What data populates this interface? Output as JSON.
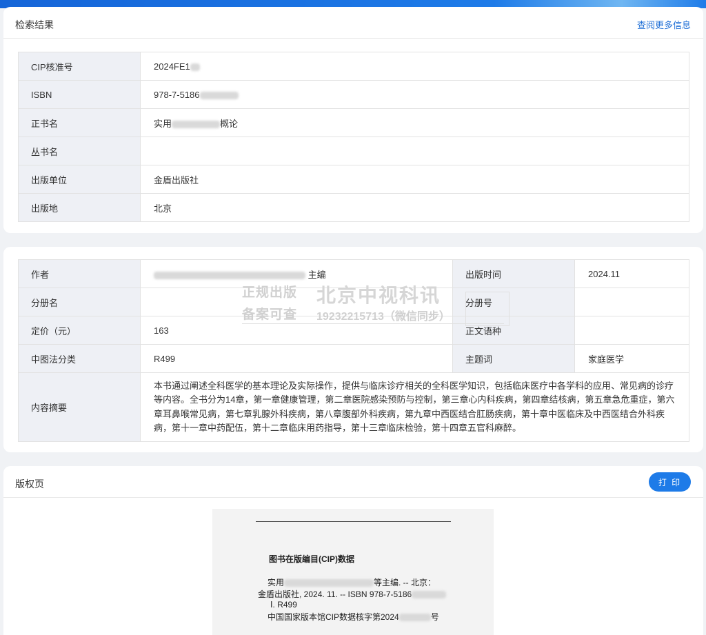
{
  "colors": {
    "accent": "#1e7be8",
    "label_bg": "#eef0f5",
    "page_bg": "#f0f2f5"
  },
  "results": {
    "title": "检索结果",
    "more_link": "查阅更多信息",
    "rows": [
      {
        "label": "CIP核准号",
        "value": "2024FE1"
      },
      {
        "label": "ISBN",
        "value": "978-7-5186"
      },
      {
        "label": "正书名",
        "value_prefix": "实用",
        "value_suffix": "概论"
      },
      {
        "label": "丛书名",
        "value": ""
      },
      {
        "label": "出版单位",
        "value": "金盾出版社"
      },
      {
        "label": "出版地",
        "value": "北京"
      }
    ]
  },
  "details": {
    "author_label": "作者",
    "author_suffix": "主编",
    "pubdate_label": "出版时间",
    "pubdate_value": "2024.11",
    "volume_label": "分册名",
    "volume_no_label": "分册号",
    "price_label": "定价（元）",
    "price_value": "163",
    "language_label": "正文语种",
    "clc_label": "中图法分类",
    "clc_value": "R499",
    "subject_label": "主题词",
    "subject_value": "家庭医学",
    "abstract_label": "内容摘要",
    "abstract_value": "本书通过阐述全科医学的基本理论及实际操作，提供与临床诊疗相关的全科医学知识，包括临床医疗中各学科的应用、常见病的诊疗等内容。全书分为14章，第一章健康管理，第二章医院感染预防与控制，第三章心内科疾病，第四章结核病，第五章急危重症，第六章耳鼻喉常见病，第七章乳腺外科疾病，第八章腹部外科疾病，第九章中西医结合肛肠疾病，第十章中医临床及中西医结合外科疾病，第十一章中药配伍，第十二章临床用药指导，第十三章临床检验，第十四章五官科麻醉。"
  },
  "watermark": {
    "line1": "正规出版",
    "line2": "北京中视科讯",
    "line3": "备案可查",
    "line4": "19232215713（微信同步）"
  },
  "copyright": {
    "title": "版权页",
    "print_label": "打 印",
    "cip_title": "图书在版编目(CIP)数据",
    "line1_prefix": "实用",
    "line1_suffix": "等主编. -- 北京：",
    "line2": "金盾出版社, 2024. 11. -- ISBN 978-7-5186",
    "line3": "Ⅰ. R499",
    "line4_prefix": "中国国家版本馆CIP数据核字第2024",
    "line4_suffix": "号"
  }
}
